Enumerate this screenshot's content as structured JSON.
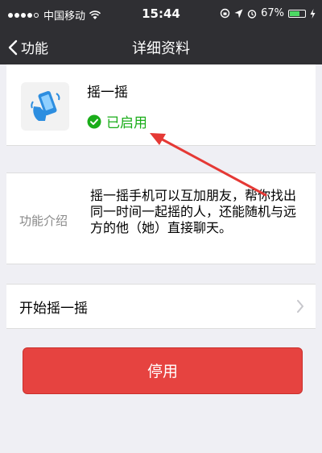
{
  "status_bar": {
    "carrier": "中国移动",
    "time": "15:44",
    "battery": "67%",
    "battery_level": 0.67
  },
  "nav": {
    "back_label": "功能",
    "title": "详细资料"
  },
  "app": {
    "name": "摇一摇",
    "status": "已启用",
    "icon": "shake-phone-icon"
  },
  "intro": {
    "label": "功能介绍",
    "text": "摇一摇手机可以互加朋友，帮你找出同一时间一起摇的人，还能随机与远方的他（她）直接聊天。"
  },
  "start": {
    "label": "开始摇一摇"
  },
  "disable_button": {
    "label": "停用"
  },
  "colors": {
    "nav_bg": "#2f2f33",
    "enabled_green": "#1aad19",
    "danger_red": "#e64340",
    "annotation_red": "#e53935"
  }
}
